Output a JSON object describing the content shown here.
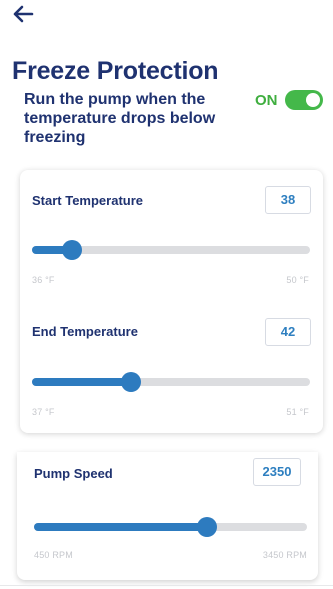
{
  "header": {
    "back_icon": "arrow-left-icon"
  },
  "page": {
    "title": "Freeze Protection",
    "description": "Run the pump when the temperature drops below freezing",
    "toggle": {
      "label": "ON",
      "on": true,
      "color": "#44b84a"
    }
  },
  "start_temperature": {
    "label": "Start Temperature",
    "value": "38",
    "min_label": "36 °F",
    "max_label": "50 °F",
    "min": 36,
    "max": 50,
    "current": 38
  },
  "end_temperature": {
    "label": "End Temperature",
    "value": "42",
    "min_label": "37 °F",
    "max_label": "51 °F",
    "min": 37,
    "max": 51,
    "current": 42
  },
  "pump_speed": {
    "label": "Pump Speed",
    "value": "2350",
    "min_label": "450 RPM",
    "max_label": "3450 RPM",
    "min": 450,
    "max": 3450,
    "current": 2350
  },
  "colors": {
    "accent": "#2d7bbf",
    "title": "#1f3270",
    "toggle_on": "#44b84a"
  }
}
